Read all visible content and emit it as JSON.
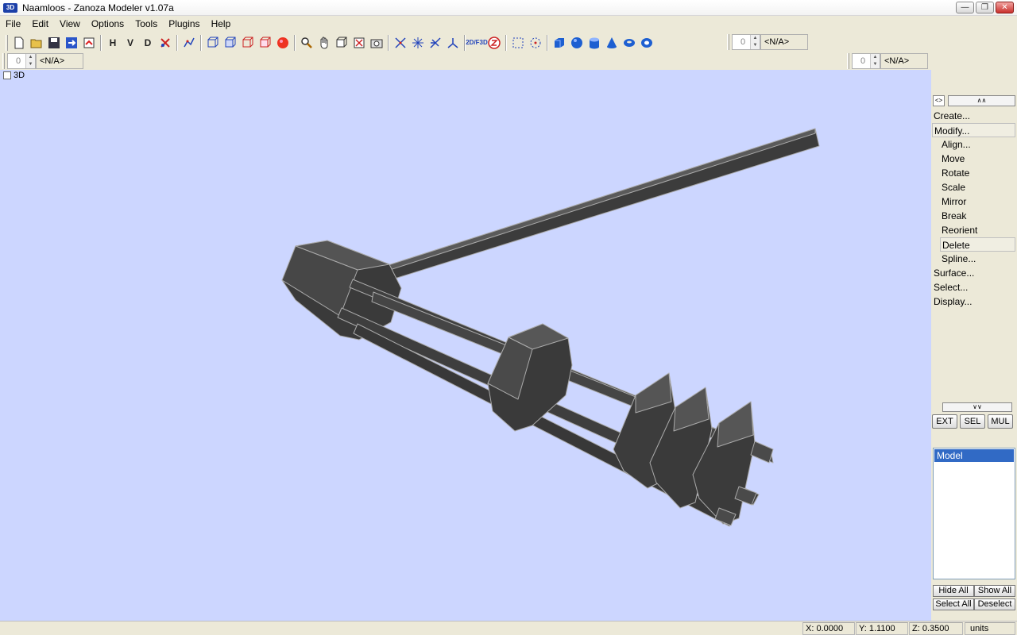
{
  "window": {
    "icon_text": "3D",
    "title": "Naamloos - Zanoza Modeler v1.07a",
    "controls": [
      "minimize-icon",
      "restore-icon",
      "close-icon"
    ]
  },
  "menu": [
    "File",
    "Edit",
    "View",
    "Options",
    "Tools",
    "Plugins",
    "Help"
  ],
  "toolbar": {
    "text_buttons": [
      "H",
      "V",
      "D"
    ],
    "icons": [
      "new-file-icon",
      "open-file-icon",
      "save-icon",
      "save-as-icon",
      "revert-icon",
      "hide-icon",
      "vertex-icon",
      "delete-vertex-icon",
      "graph-icon",
      "cube-view-icon",
      "front-view-icon",
      "side-view-icon",
      "box-view-icon",
      "render-icon",
      "zoom-icon",
      "pan-icon",
      "box-icon",
      "box-select-icon",
      "camera-icon",
      "axis-icon",
      "star-icon",
      "cross-icon",
      "tripod-icon",
      "2d-3d-icon",
      "z-icon",
      "rect-select-icon",
      "circle-select-icon",
      "cube-primitive-icon",
      "sphere-primitive-icon",
      "cylinder-primitive-icon",
      "cone-primitive-icon",
      "torus-primitive-icon",
      "tube-primitive-icon"
    ],
    "mode_2d3d": "2D/F3D"
  },
  "spinners": {
    "top_right": {
      "value": "0",
      "label": "<N/A>"
    },
    "left": {
      "value": "0",
      "label": "<N/A>"
    },
    "right": {
      "value": "0",
      "label": "<N/A>"
    }
  },
  "viewport": {
    "label": "3D",
    "background": "#ccd6ff"
  },
  "panel": {
    "commands": [
      {
        "label": "Create...",
        "level": 0,
        "boxed": false
      },
      {
        "label": "Modify...",
        "level": 0,
        "boxed": true
      },
      {
        "label": "Align...",
        "level": 1,
        "boxed": false
      },
      {
        "label": "Move",
        "level": 1,
        "boxed": false
      },
      {
        "label": "Rotate",
        "level": 1,
        "boxed": false
      },
      {
        "label": "Scale",
        "level": 1,
        "boxed": false
      },
      {
        "label": "Mirror",
        "level": 1,
        "boxed": false
      },
      {
        "label": "Break",
        "level": 1,
        "boxed": false
      },
      {
        "label": "Reorient",
        "level": 1,
        "boxed": false
      },
      {
        "label": "Delete",
        "level": 1,
        "boxed": true
      },
      {
        "label": "Spline...",
        "level": 1,
        "boxed": false
      },
      {
        "label": "Surface...",
        "level": 0,
        "boxed": false
      },
      {
        "label": "Select...",
        "level": 0,
        "boxed": false
      },
      {
        "label": "Display...",
        "level": 0,
        "boxed": false
      }
    ],
    "mode_buttons": [
      "EXT",
      "SEL",
      "MUL"
    ],
    "model_list": [
      "Model"
    ],
    "select_buttons": [
      "Hide All",
      "Show All",
      "Select All",
      "Deselect"
    ]
  },
  "status": {
    "x": "X: 0.0000",
    "y": "Y: 1.1100",
    "z": "Z: 0.3500",
    "units": "units"
  }
}
